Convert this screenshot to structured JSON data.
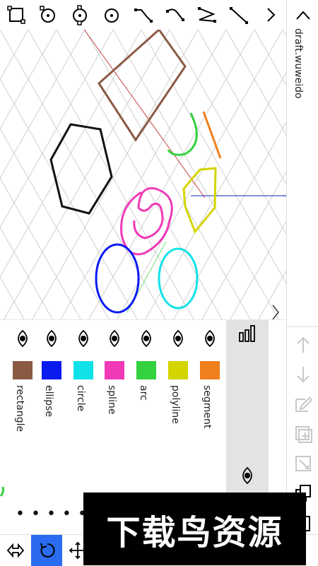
{
  "app": {
    "title": "draft.wuweido"
  },
  "toolbar": {
    "tools": [
      {
        "name": "rectangle-select-icon"
      },
      {
        "name": "circle-point-icon"
      },
      {
        "name": "circle-tangent-icon"
      },
      {
        "name": "circle-center-icon"
      },
      {
        "name": "curve-a-icon"
      },
      {
        "name": "curve-b-icon"
      },
      {
        "name": "zigzag-icon"
      },
      {
        "name": "line-segment-icon"
      },
      {
        "name": "chevron-right-icon"
      }
    ]
  },
  "layers": {
    "items": [
      {
        "label": "rectangle",
        "color": "#8b5a44"
      },
      {
        "label": "ellipse",
        "color": "#0a1bf0"
      },
      {
        "label": "circle",
        "color": "#10e2e8"
      },
      {
        "label": "spline",
        "color": "#f03ab7"
      },
      {
        "label": "arc",
        "color": "#33d23e"
      },
      {
        "label": "polyline",
        "color": "#d4d400"
      },
      {
        "label": "segment",
        "color": "#f07f1d"
      }
    ],
    "dots": "• •   • • •   • • •"
  },
  "overlay": {
    "text": "下载鸟资源"
  },
  "colors": {
    "accent": "#2a6bf0",
    "axis_x": "#3b4fc4",
    "axis_y": "#c94040",
    "grid": "#cfcfcf"
  }
}
